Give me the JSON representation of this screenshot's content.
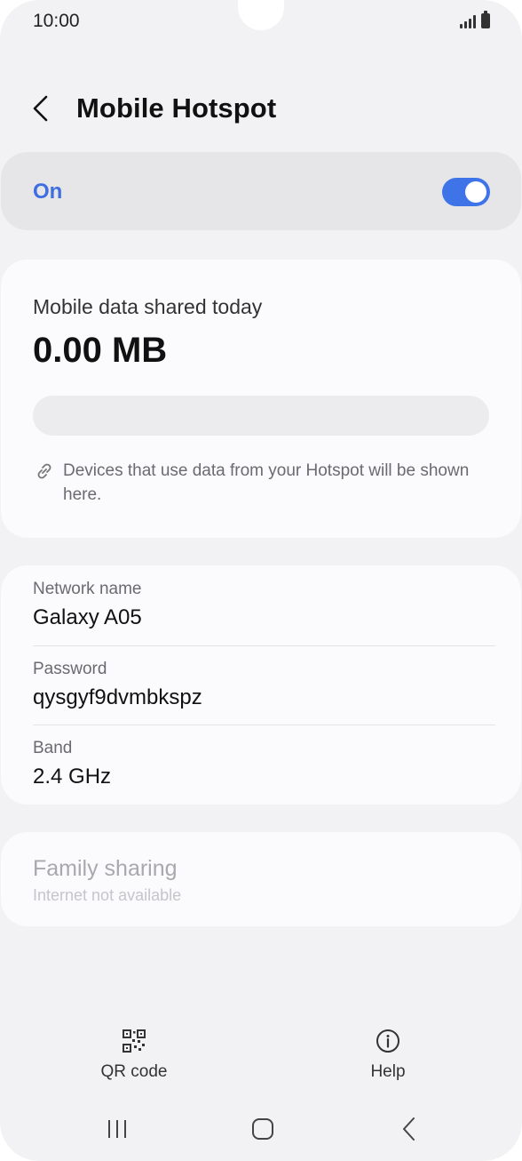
{
  "status_bar": {
    "time": "10:00"
  },
  "header": {
    "title": "Mobile Hotspot",
    "back_icon": "chevron-left-icon"
  },
  "master_switch": {
    "label": "On",
    "enabled": true,
    "accent_color": "#3e74e8"
  },
  "usage": {
    "label": "Mobile data shared today",
    "value": "0.00 MB",
    "progress_fraction": 0,
    "note": "Devices that use data from your Hotspot will be shown here.",
    "note_icon": "link-icon"
  },
  "network": {
    "rows": [
      {
        "label": "Network name",
        "value": "Galaxy A05"
      },
      {
        "label": "Password",
        "value": "qysgyf9dvmbkspz"
      },
      {
        "label": "Band",
        "value": "2.4 GHz"
      }
    ]
  },
  "family_sharing": {
    "title": "Family sharing",
    "subtitle": "Internet not available"
  },
  "bottom_actions": {
    "qr": {
      "label": "QR code",
      "icon": "qr-code-icon"
    },
    "help": {
      "label": "Help",
      "icon": "info-icon"
    }
  },
  "nav_bar": {
    "recents_icon": "recents-icon",
    "home_icon": "home-icon",
    "back_icon": "back-icon"
  }
}
